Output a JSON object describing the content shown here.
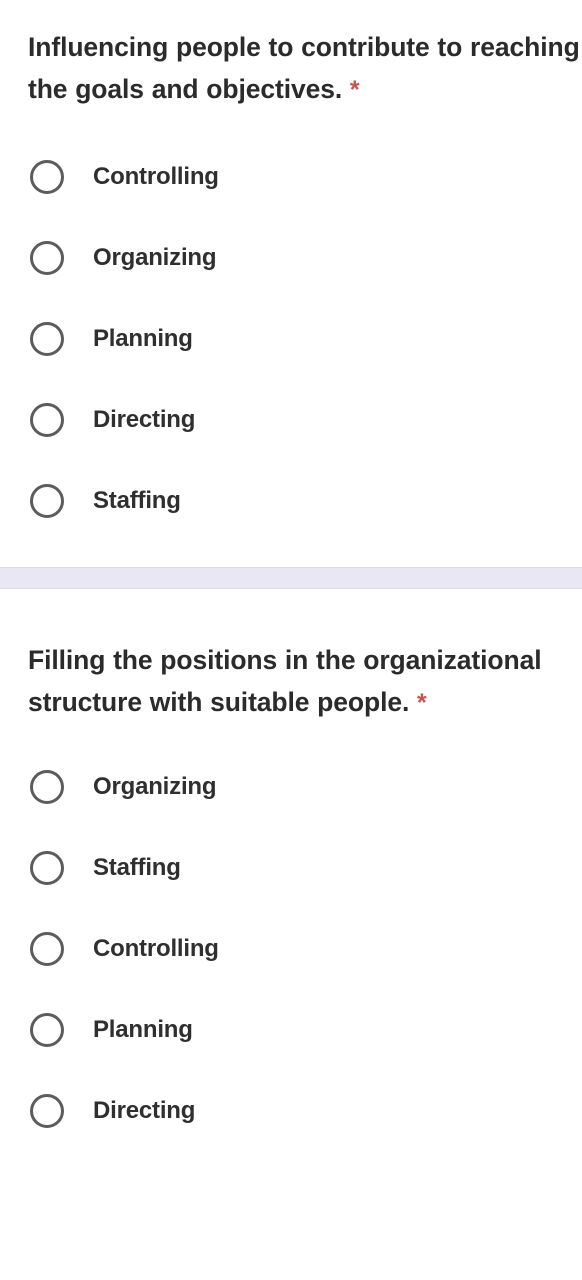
{
  "form": {
    "questions": [
      {
        "id": "q1",
        "text": "Influencing people to contribute to reaching the goals and objectives.",
        "required_marker": "*",
        "required": true,
        "options": [
          {
            "label": "Controlling",
            "selected": false
          },
          {
            "label": "Organizing",
            "selected": false
          },
          {
            "label": "Planning",
            "selected": false
          },
          {
            "label": "Directing",
            "selected": false
          },
          {
            "label": "Staffing",
            "selected": false
          }
        ]
      },
      {
        "id": "q2",
        "text": "Filling the positions in the organizational structure with suitable people.",
        "required_marker": "*",
        "required": true,
        "options": [
          {
            "label": "Organizing",
            "selected": false
          },
          {
            "label": "Staffing",
            "selected": false
          },
          {
            "label": "Controlling",
            "selected": false
          },
          {
            "label": "Planning",
            "selected": false
          },
          {
            "label": "Directing",
            "selected": false
          }
        ]
      }
    ]
  },
  "colors": {
    "background": "#ffffff",
    "text": "#2b2b2b",
    "option_text": "#2f2f2f",
    "required_star": "#c5544c",
    "radio_border": "#5c5c5c",
    "separator_band": "#e9e7f4"
  }
}
